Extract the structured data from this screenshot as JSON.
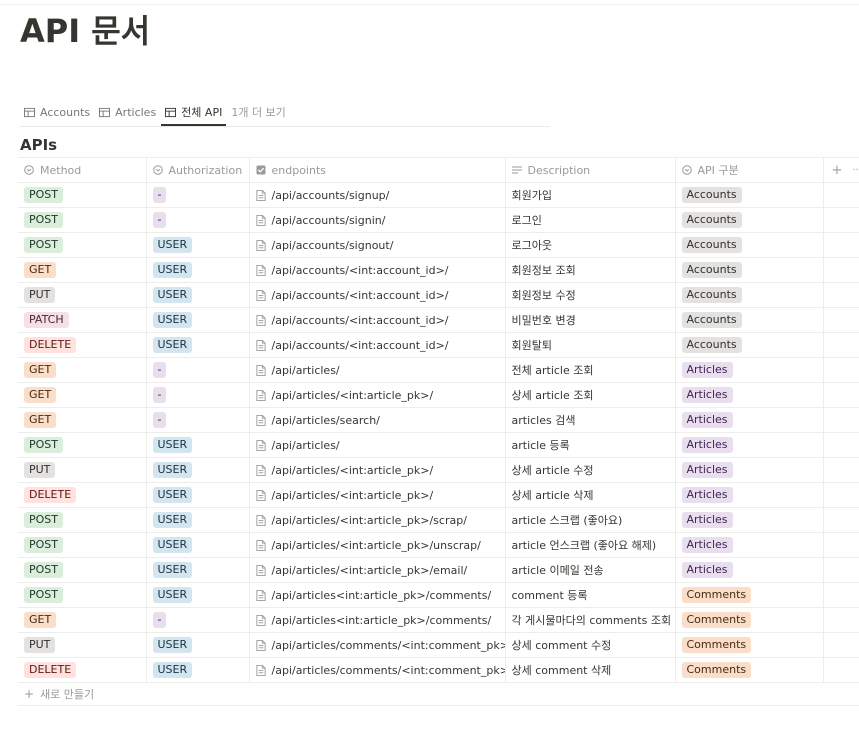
{
  "page": {
    "title": "API 문서"
  },
  "tabs": [
    {
      "label": "Accounts",
      "active": false
    },
    {
      "label": "Articles",
      "active": false
    },
    {
      "label": "전체 API",
      "active": true
    }
  ],
  "tabs_more": "1개 더 보기",
  "database": {
    "title": "APIs"
  },
  "columns": {
    "method": "Method",
    "authorization": "Authorization",
    "endpoints": "endpoints",
    "description": "Description",
    "group": "API 구분",
    "add": "+",
    "more": "···"
  },
  "tag_colors": {
    "POST": {
      "bg": "#dbeddb",
      "fg": "#1c3829"
    },
    "GET": {
      "bg": "#fadec9",
      "fg": "#49290e"
    },
    "PUT": {
      "bg": "#e3e2e0",
      "fg": "#32302c"
    },
    "PATCH": {
      "bg": "#f5e0e9",
      "fg": "#4c2337"
    },
    "DELETE": {
      "bg": "#ffe2dd",
      "fg": "#5d1715"
    },
    "-": {
      "bg": "#e8deee",
      "fg": "#412454"
    },
    "USER": {
      "bg": "#d3e5ef",
      "fg": "#183347"
    },
    "Accounts": {
      "bg": "#e3e2e0",
      "fg": "#32302c"
    },
    "Articles": {
      "bg": "#e8deee",
      "fg": "#412454"
    },
    "Comments": {
      "bg": "#fadec9",
      "fg": "#49290e"
    }
  },
  "rows": [
    {
      "method": "POST",
      "auth": "-",
      "endpoint": "/api/accounts/signup/",
      "description": "회원가입",
      "group": "Accounts"
    },
    {
      "method": "POST",
      "auth": "-",
      "endpoint": "/api/accounts/signin/",
      "description": "로그인",
      "group": "Accounts"
    },
    {
      "method": "POST",
      "auth": "USER",
      "endpoint": "/api/accounts/signout/",
      "description": "로그아웃",
      "group": "Accounts"
    },
    {
      "method": "GET",
      "auth": "USER",
      "endpoint": "/api/accounts/<int:account_id>/",
      "description": "회원정보 조회",
      "group": "Accounts"
    },
    {
      "method": "PUT",
      "auth": "USER",
      "endpoint": "/api/accounts/<int:account_id>/",
      "description": "회원정보 수정",
      "group": "Accounts"
    },
    {
      "method": "PATCH",
      "auth": "USER",
      "endpoint": "/api/accounts/<int:account_id>/",
      "description": "비밀번호 변경",
      "group": "Accounts"
    },
    {
      "method": "DELETE",
      "auth": "USER",
      "endpoint": "/api/accounts/<int:account_id>/",
      "description": "회원탈퇴",
      "group": "Accounts"
    },
    {
      "method": "GET",
      "auth": "-",
      "endpoint": "/api/articles/",
      "description": "전체 article 조회",
      "group": "Articles"
    },
    {
      "method": "GET",
      "auth": "-",
      "endpoint": "/api/articles/<int:article_pk>/",
      "description": "상세 article 조회",
      "group": "Articles"
    },
    {
      "method": "GET",
      "auth": "-",
      "endpoint": "/api/articles/search/",
      "description": "articles 검색",
      "group": "Articles"
    },
    {
      "method": "POST",
      "auth": "USER",
      "endpoint": "/api/articles/",
      "description": "article 등록",
      "group": "Articles"
    },
    {
      "method": "PUT",
      "auth": "USER",
      "endpoint": "/api/articles/<int:article_pk>/",
      "description": "상세 article 수정",
      "group": "Articles"
    },
    {
      "method": "DELETE",
      "auth": "USER",
      "endpoint": "/api/articles/<int:article_pk>/",
      "description": "상세 article 삭제",
      "group": "Articles"
    },
    {
      "method": "POST",
      "auth": "USER",
      "endpoint": "/api/articles/<int:article_pk>/scrap/",
      "description": "article 스크랩 (좋아요)",
      "group": "Articles"
    },
    {
      "method": "POST",
      "auth": "USER",
      "endpoint": "/api/articles/<int:article_pk>/unscrap/",
      "description": "article 언스크랩 (좋아요 해제)",
      "group": "Articles"
    },
    {
      "method": "POST",
      "auth": "USER",
      "endpoint": "/api/articles/<int:article_pk>/email/",
      "description": "article 이메일 전송",
      "group": "Articles"
    },
    {
      "method": "POST",
      "auth": "USER",
      "endpoint": "/api/articles<int:article_pk>/comments/",
      "description": "comment 등록",
      "group": "Comments"
    },
    {
      "method": "GET",
      "auth": "-",
      "endpoint": "/api/articles<int:article_pk>/comments/",
      "description": "각 게시물마다의 comments 조회",
      "group": "Comments"
    },
    {
      "method": "PUT",
      "auth": "USER",
      "endpoint": "/api/articles/comments/<int:comment_pk>/",
      "description": "상세 comment 수정",
      "group": "Comments"
    },
    {
      "method": "DELETE",
      "auth": "USER",
      "endpoint": "/api/articles/comments/<int:comment_pk>/",
      "description": "상세 comment 삭제",
      "group": "Comments"
    }
  ],
  "new_row_label": "새로 만들기"
}
